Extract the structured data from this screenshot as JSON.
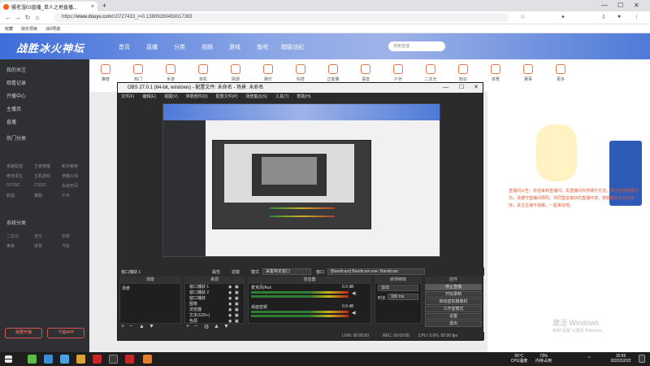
{
  "browser": {
    "tab_title": "骚老湿03直播_单人之地直播...",
    "tab_close": "×",
    "new_tab": "+",
    "url_prefix": "https://",
    "url_domain": "www.douyu.com",
    "url_path": "/10727433_r=0.13809269459017383",
    "window_controls": [
      "—",
      "☐",
      "✕"
    ],
    "bookmarks": [
      "收藏",
      "快乐项目",
      "360导航"
    ]
  },
  "douyu": {
    "logo": "战胜冰火神坛",
    "nav": [
      "首页",
      "直播",
      "分类",
      "视频",
      "游戏",
      "鱼吧",
      "超级战纪"
    ],
    "search_placeholder": "搜索直播",
    "left_items": [
      "我的关注",
      "观看记录",
      "开播中心",
      "主播页",
      "直播",
      "热门分类",
      "系统分类"
    ],
    "left_sub": [
      [
        "英雄联盟",
        "王者荣耀",
        "和平精英"
      ],
      [
        "绝地求生",
        "主机游戏",
        "穿越火线"
      ],
      [
        "DOTA2",
        "CSGO",
        "永劫无间"
      ],
      [
        "颜值",
        "舞蹈",
        "户外"
      ],
      [
        "二次元",
        "音乐",
        "科技"
      ],
      [
        "美食",
        "体育",
        "汽车"
      ]
    ],
    "left_buttons": [
      "我要开播",
      "下载APP"
    ],
    "categories": [
      "推荐",
      "热门",
      "手游",
      "单机",
      "网游",
      "娱乐",
      "科技",
      "正能量",
      "语音",
      "户外",
      "二次元",
      "知识",
      "体育",
      "赛事",
      "更多"
    ],
    "right_text": "直播间公告：欢迎来到直播间，本直播间仅供娱乐交流，禁止任何违规行为，请遵守直播间规则，共同营造良好的直播环境，感谢各位水友的支持，关注主播不迷路，一起来玩吧。"
  },
  "obs": {
    "title": "OBS 27.0.1 (64-bit, windows) - 配置文件: 未命名 - 场景: 未命名",
    "window_controls": [
      "—",
      "☐",
      "✕"
    ],
    "menu": [
      "文件(F)",
      "编辑(E)",
      "视图(V)",
      "停靠部件(D)",
      "配置文件(P)",
      "场景集合(S)",
      "工具(T)",
      "帮助(H)"
    ],
    "scene_label": "窗口捕获 1",
    "toolbar_items": [
      "属性",
      "滤镜"
    ],
    "mode_label": "模式",
    "mode_value": "采集特定窗口",
    "window_label": "窗口",
    "window_value": "[Bandicam] Bandicam.exe: Bandicam",
    "docks": {
      "scenes": "场景",
      "sources": "来源",
      "mixer": "混音器",
      "transitions": "转场特效",
      "controls": "控件"
    },
    "scene_items": [
      "场景"
    ],
    "source_items": [
      "窗口捕获 1",
      "窗口捕获 2",
      "窗口捕获",
      "图像",
      "浏览器",
      "文本(GDI+)",
      "色源"
    ],
    "mixer_items": [
      {
        "name": "麦克风/Aux",
        "db": "0.0 dB"
      },
      {
        "name": "桌面音频",
        "db": "0.0 dB"
      }
    ],
    "transition_value": "淡出",
    "duration_label": "时长",
    "duration_value": "300 ms",
    "controls": [
      "停止直播",
      "开始录制",
      "启动虚拟摄像机",
      "工作室模式",
      "设置",
      "退出"
    ],
    "status": {
      "live": "LIVE: 00:00:00",
      "rec": "REC: 00:00:00",
      "cpu": "CPU: 0.6%, 60.00 fps"
    }
  },
  "watermark": {
    "title": "激活 Windows",
    "sub": "转到\"设置\"以激活 Windows。"
  },
  "taskbar": {
    "temp": "55°C",
    "temp_label": "CPU温度",
    "mem": "73%",
    "mem_label": "内存占用",
    "time": "15:55",
    "date": "2022/12/22",
    "chevron": "^"
  },
  "colors": {
    "accent": "#ff5a1f",
    "obs_bg": "#2b2b2b",
    "douyu_blue": "#3d6dd8"
  }
}
